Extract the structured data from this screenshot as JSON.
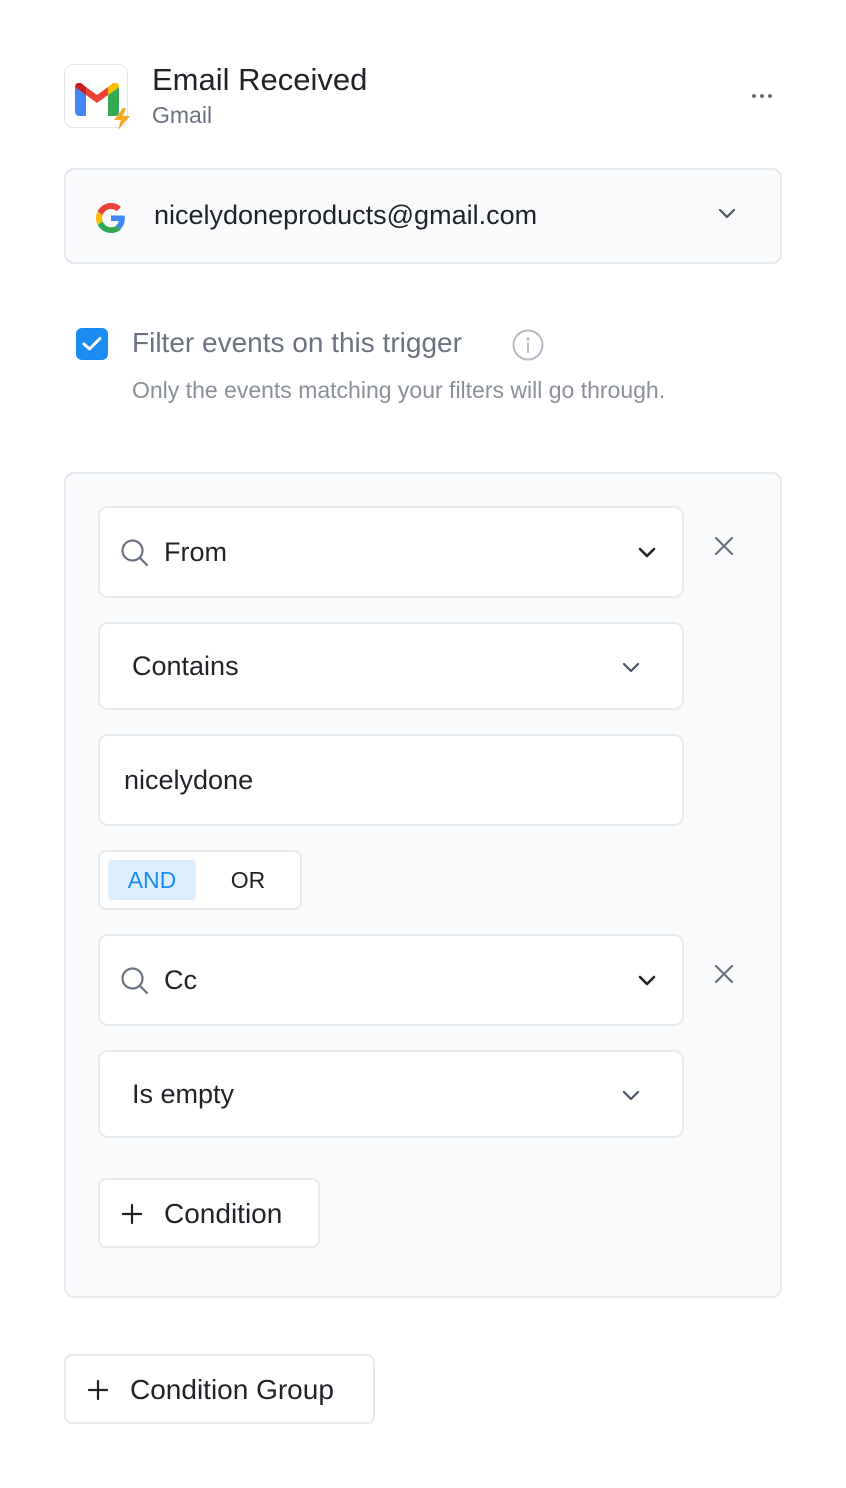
{
  "header": {
    "title": "Email Received",
    "app_name": "Gmail"
  },
  "account": {
    "email": "nicelydoneproducts@gmail.com"
  },
  "filter": {
    "checked": true,
    "label": "Filter events on this trigger",
    "description": "Only the events matching your filters will go through."
  },
  "conditions": [
    {
      "field": "From",
      "operator": "Contains",
      "value": "nicelydone"
    },
    {
      "field": "Cc",
      "operator": "Is empty"
    }
  ],
  "logic": {
    "options": [
      "AND",
      "OR"
    ],
    "selected": "AND"
  },
  "buttons": {
    "add_condition": "Condition",
    "add_condition_group": "Condition Group"
  },
  "colors": {
    "accent": "#1b8cef",
    "accent_bg": "#dbeefd",
    "border": "#e6e9ed",
    "panel_bg": "#f9fafb"
  }
}
